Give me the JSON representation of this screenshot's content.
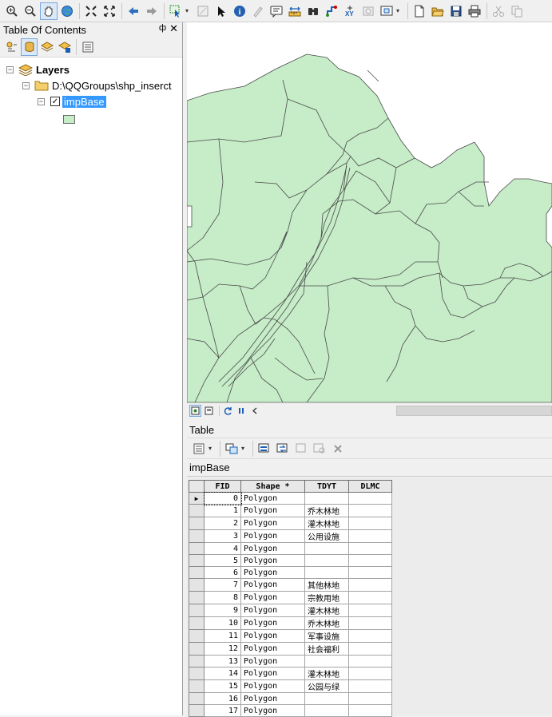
{
  "toolbar": {
    "icons": [
      "zoom-in-icon",
      "zoom-out-icon",
      "pan-icon",
      "full-extent-icon",
      "fixed-zoom-in-icon",
      "fixed-zoom-out-icon",
      "back-extent-icon",
      "forward-extent-icon",
      "select-features-icon",
      "clear-selection-icon",
      "select-elements-icon",
      "identify-icon",
      "hyperlink-icon",
      "html-popup-icon",
      "measure-icon",
      "find-icon",
      "find-route-icon",
      "go-to-xy-icon",
      "time-slider-icon",
      "create-viewer-icon",
      "new-document-icon",
      "open-icon",
      "save-icon",
      "print-icon",
      "cut-icon",
      "copy-icon"
    ]
  },
  "toc": {
    "title": "Table Of Contents",
    "pin_glyph": "ф",
    "close_glyph": "✕",
    "tree": {
      "root_label": "Layers",
      "folder_label": "D:\\QQGroups\\shp_inserct",
      "layer_label": "impBase",
      "layer_checked": true,
      "swatch_color": "#c6ecc8"
    }
  },
  "map": {
    "fill_color": "#c6ecc8",
    "stroke_color": "#4a4a4a"
  },
  "table_pane": {
    "title": "Table",
    "tab_label": "impBase",
    "columns": [
      "FID",
      "Shape *",
      "TDYT",
      "DLMC"
    ],
    "rows": [
      {
        "fid": "0",
        "shape": "Polygon",
        "tdyt": "",
        "dlmc": "",
        "current": true
      },
      {
        "fid": "1",
        "shape": "Polygon",
        "tdyt": "乔木林地",
        "dlmc": ""
      },
      {
        "fid": "2",
        "shape": "Polygon",
        "tdyt": "灌木林地",
        "dlmc": ""
      },
      {
        "fid": "3",
        "shape": "Polygon",
        "tdyt": "公用设施",
        "dlmc": ""
      },
      {
        "fid": "4",
        "shape": "Polygon",
        "tdyt": "",
        "dlmc": ""
      },
      {
        "fid": "5",
        "shape": "Polygon",
        "tdyt": "",
        "dlmc": ""
      },
      {
        "fid": "6",
        "shape": "Polygon",
        "tdyt": "",
        "dlmc": ""
      },
      {
        "fid": "7",
        "shape": "Polygon",
        "tdyt": "其他林地",
        "dlmc": ""
      },
      {
        "fid": "8",
        "shape": "Polygon",
        "tdyt": "宗教用地",
        "dlmc": ""
      },
      {
        "fid": "9",
        "shape": "Polygon",
        "tdyt": "灌木林地",
        "dlmc": ""
      },
      {
        "fid": "10",
        "shape": "Polygon",
        "tdyt": "乔木林地",
        "dlmc": ""
      },
      {
        "fid": "11",
        "shape": "Polygon",
        "tdyt": "军事设施",
        "dlmc": ""
      },
      {
        "fid": "12",
        "shape": "Polygon",
        "tdyt": "社会福利",
        "dlmc": ""
      },
      {
        "fid": "13",
        "shape": "Polygon",
        "tdyt": "",
        "dlmc": ""
      },
      {
        "fid": "14",
        "shape": "Polygon",
        "tdyt": "灌木林地",
        "dlmc": ""
      },
      {
        "fid": "15",
        "shape": "Polygon",
        "tdyt": "公园与绿",
        "dlmc": ""
      },
      {
        "fid": "16",
        "shape": "Polygon",
        "tdyt": "",
        "dlmc": ""
      },
      {
        "fid": "17",
        "shape": "Polygon",
        "tdyt": "",
        "dlmc": ""
      }
    ]
  }
}
